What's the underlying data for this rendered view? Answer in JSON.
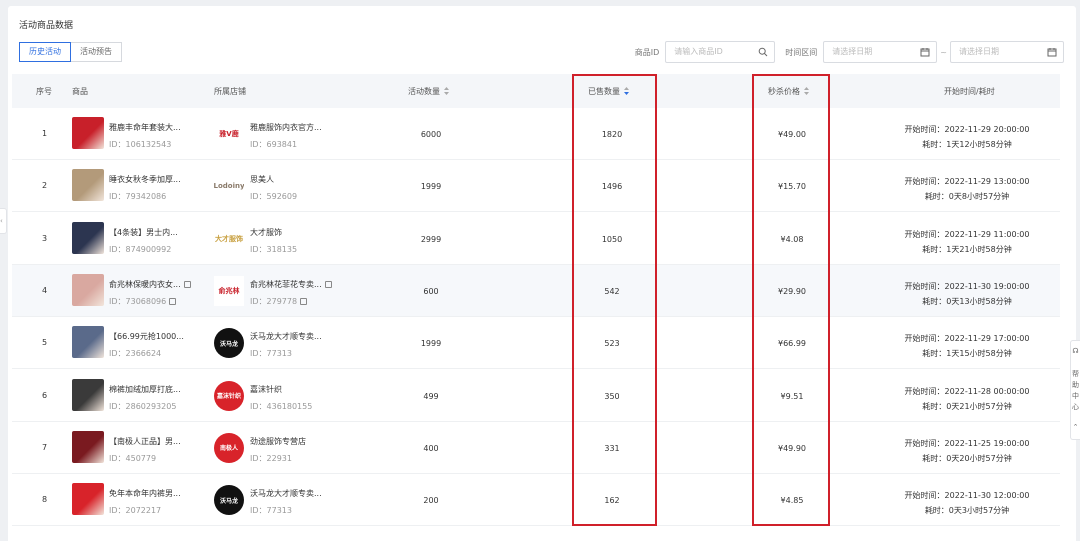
{
  "page_title": "活动商品数据",
  "tabs": [
    {
      "label": "历史活动",
      "active": true
    },
    {
      "label": "活动预告",
      "active": false
    }
  ],
  "filters": {
    "product_id_label": "商品ID",
    "product_id_placeholder": "请输入商品ID",
    "time_range_label": "时间区间",
    "start_date_placeholder": "请选择日期",
    "end_date_placeholder": "请选择日期",
    "separator": "~"
  },
  "table": {
    "headers": {
      "index": "序号",
      "product": "商品",
      "shop": "所属店铺",
      "activity_qty": "活动数量",
      "sold_qty": "已售数量",
      "flash_price": "秒杀价格",
      "start_time": "开始时间/耗时"
    },
    "rows": [
      {
        "index": "1",
        "product_name": "雅鹿丰命年套装大...",
        "product_id": "ID：106132543",
        "shop_name": "雅鹿服饰内衣官方...",
        "shop_id": "ID：693841",
        "activity_qty": "6000",
        "sold_qty": "1820",
        "price": "¥49.00",
        "start": "开始时间：2022-11-29 20:00:00",
        "duration": "耗时：1天12小时58分钟",
        "pcolor": "#c8202a",
        "scolor": "#ffffff",
        "stext": "雅V鹿",
        "stcolor": "#c8202a"
      },
      {
        "index": "2",
        "product_name": "睡衣女秋冬季加厚...",
        "product_id": "ID：79342086",
        "shop_name": "思美人",
        "shop_id": "ID：592609",
        "activity_qty": "1999",
        "sold_qty": "1496",
        "price": "¥15.70",
        "start": "开始时间：2022-11-29 13:00:00",
        "duration": "耗时：0天8小时57分钟",
        "pcolor": "#b39a7a",
        "scolor": "#ffffff",
        "stext": "Lodoiny",
        "stcolor": "#8a7a6a"
      },
      {
        "index": "3",
        "product_name": "【4条装】男士内...",
        "product_id": "ID：874900992",
        "shop_name": "大才服饰",
        "shop_id": "ID：318135",
        "activity_qty": "2999",
        "sold_qty": "1050",
        "price": "¥4.08",
        "start": "开始时间：2022-11-29 11:00:00",
        "duration": "耗时：1天21小时58分钟",
        "pcolor": "#2c3550",
        "scolor": "#ffffff",
        "stext": "大才服饰",
        "stcolor": "#c8a040"
      },
      {
        "index": "4",
        "product_name": "俞兆林保暖内衣女...",
        "product_id": "ID：73068096",
        "shop_name": "俞兆林花菲花专卖...",
        "shop_id": "ID：279778",
        "activity_qty": "600",
        "sold_qty": "542",
        "price": "¥29.90",
        "start": "开始时间：2022-11-30 19:00:00",
        "duration": "耗时：0天13小时58分钟",
        "pcolor": "#d9a8a0",
        "scolor": "#ffffff",
        "stext": "俞兆林",
        "stcolor": "#c8202a"
      },
      {
        "index": "5",
        "product_name": "【66.99元抢1000...",
        "product_id": "ID：2366624",
        "shop_name": "沃马龙大才顺专卖...",
        "shop_id": "ID：77313",
        "activity_qty": "1999",
        "sold_qty": "523",
        "price": "¥66.99",
        "start": "开始时间：2022-11-29 17:00:00",
        "duration": "耗时：1天15小时58分钟",
        "pcolor": "#5a6a8a",
        "scolor": "#111111",
        "stext": "沃马龙",
        "stcolor": "#ffffff"
      },
      {
        "index": "6",
        "product_name": "棉裤加绒加厚打底...",
        "product_id": "ID：2860293205",
        "shop_name": "嘉沫针织",
        "shop_id": "ID：436180155",
        "activity_qty": "499",
        "sold_qty": "350",
        "price": "¥9.51",
        "start": "开始时间：2022-11-28 00:00:00",
        "duration": "耗时：0天21小时57分钟",
        "pcolor": "#3a3a3a",
        "scolor": "#d8232a",
        "stext": "嘉沫针织",
        "stcolor": "#ffffff"
      },
      {
        "index": "7",
        "product_name": "【南极人正品】男...",
        "product_id": "ID：450779",
        "shop_name": "劲途服饰专营店",
        "shop_id": "ID：22931",
        "activity_qty": "400",
        "sold_qty": "331",
        "price": "¥49.90",
        "start": "开始时间：2022-11-25 19:00:00",
        "duration": "耗时：0天20小时57分钟",
        "pcolor": "#7a1a20",
        "scolor": "#d8232a",
        "stext": "南极人",
        "stcolor": "#ffffff"
      },
      {
        "index": "8",
        "product_name": "免年本命年内裤男...",
        "product_id": "ID：2072217",
        "shop_name": "沃马龙大才顺专卖...",
        "shop_id": "ID：77313",
        "activity_qty": "200",
        "sold_qty": "162",
        "price": "¥4.85",
        "start": "开始时间：2022-11-30 12:00:00",
        "duration": "耗时：0天3小时57分钟",
        "pcolor": "#d8232a",
        "scolor": "#111111",
        "stext": "沃马龙",
        "stcolor": "#ffffff"
      }
    ]
  },
  "side_panel": {
    "help_label": "帮助中心"
  },
  "colors": {
    "accent": "#2f6fe0",
    "highlight_border": "#d0202a"
  }
}
